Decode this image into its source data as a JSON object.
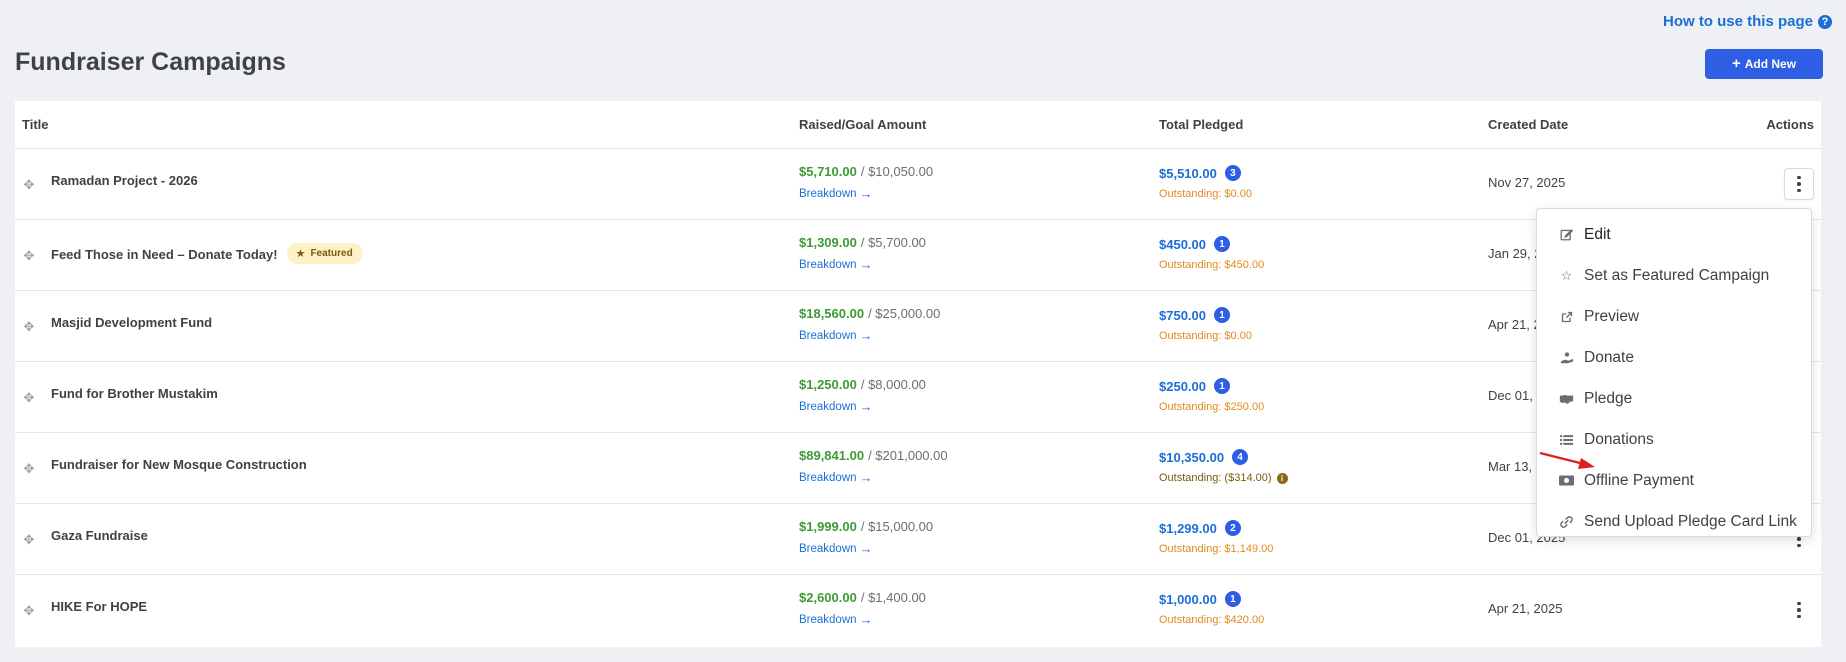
{
  "header": {
    "help_link": "How to use this page",
    "page_title": "Fundraiser Campaigns",
    "add_new_label": "Add New"
  },
  "table": {
    "columns": {
      "title": "Title",
      "raised_goal": "Raised/Goal Amount",
      "total_pledged": "Total Pledged",
      "created_date": "Created Date",
      "actions": "Actions"
    },
    "breakdown_label": "Breakdown",
    "rows": [
      {
        "title": "Ramadan Project - 2026",
        "featured": false,
        "raised": "$5,710.00",
        "goal": "/ $10,050.00",
        "pledged": "$5,510.00",
        "pledge_count": "3",
        "outstanding": "Outstanding: $0.00",
        "outstanding_alert": false,
        "created": "Nov 27, 2025"
      },
      {
        "title": "Feed Those in Need – Donate Today!",
        "featured": true,
        "raised": "$1,309.00",
        "goal": "/ $5,700.00",
        "pledged": "$450.00",
        "pledge_count": "1",
        "outstanding": "Outstanding: $450.00",
        "outstanding_alert": false,
        "created": "Jan 29, 2"
      },
      {
        "title": "Masjid Development Fund",
        "featured": false,
        "raised": "$18,560.00",
        "goal": "/ $25,000.00",
        "pledged": "$750.00",
        "pledge_count": "1",
        "outstanding": "Outstanding: $0.00",
        "outstanding_alert": false,
        "created": "Apr 21, 2"
      },
      {
        "title": "Fund for Brother Mustakim",
        "featured": false,
        "raised": "$1,250.00",
        "goal": "/ $8,000.00",
        "pledged": "$250.00",
        "pledge_count": "1",
        "outstanding": "Outstanding: $250.00",
        "outstanding_alert": false,
        "created": "Dec 01, 2"
      },
      {
        "title": "Fundraiser for New Mosque Construction",
        "featured": false,
        "raised": "$89,841.00",
        "goal": "/ $201,000.00",
        "pledged": "$10,350.00",
        "pledge_count": "4",
        "outstanding": "Outstanding: ($314.00)",
        "outstanding_alert": true,
        "created": "Mar 13, 2"
      },
      {
        "title": "Gaza Fundraise",
        "featured": false,
        "raised": "$1,999.00",
        "goal": "/ $15,000.00",
        "pledged": "$1,299.00",
        "pledge_count": "2",
        "outstanding": "Outstanding: $1,149.00",
        "outstanding_alert": false,
        "created": "Dec 01, 2025"
      },
      {
        "title": "HIKE For HOPE",
        "featured": false,
        "raised": "$2,600.00",
        "goal": "/ $1,400.00",
        "pledged": "$1,000.00",
        "pledge_count": "1",
        "outstanding": "Outstanding: $420.00",
        "outstanding_alert": false,
        "created": "Apr 21, 2025"
      }
    ]
  },
  "featured_badge": "Featured",
  "action_menu": {
    "items": [
      {
        "label": "Edit",
        "icon": "edit-icon"
      },
      {
        "label": "Set as Featured Campaign",
        "icon": "star-outline-icon"
      },
      {
        "label": "Preview",
        "icon": "external-link-icon"
      },
      {
        "label": "Donate",
        "icon": "hand-coin-icon"
      },
      {
        "label": "Pledge",
        "icon": "handshake-icon"
      },
      {
        "label": "Donations",
        "icon": "list-icon"
      },
      {
        "label": "Offline Payment",
        "icon": "money-icon"
      },
      {
        "label": "Send Upload Pledge Card Link",
        "icon": "link-icon"
      }
    ]
  },
  "colors": {
    "accent": "#2d5ee4",
    "link": "#1a6fd6",
    "raised": "#3d9a36",
    "outstanding": "#e08a1e",
    "annotation_arrow": "#e02020"
  }
}
